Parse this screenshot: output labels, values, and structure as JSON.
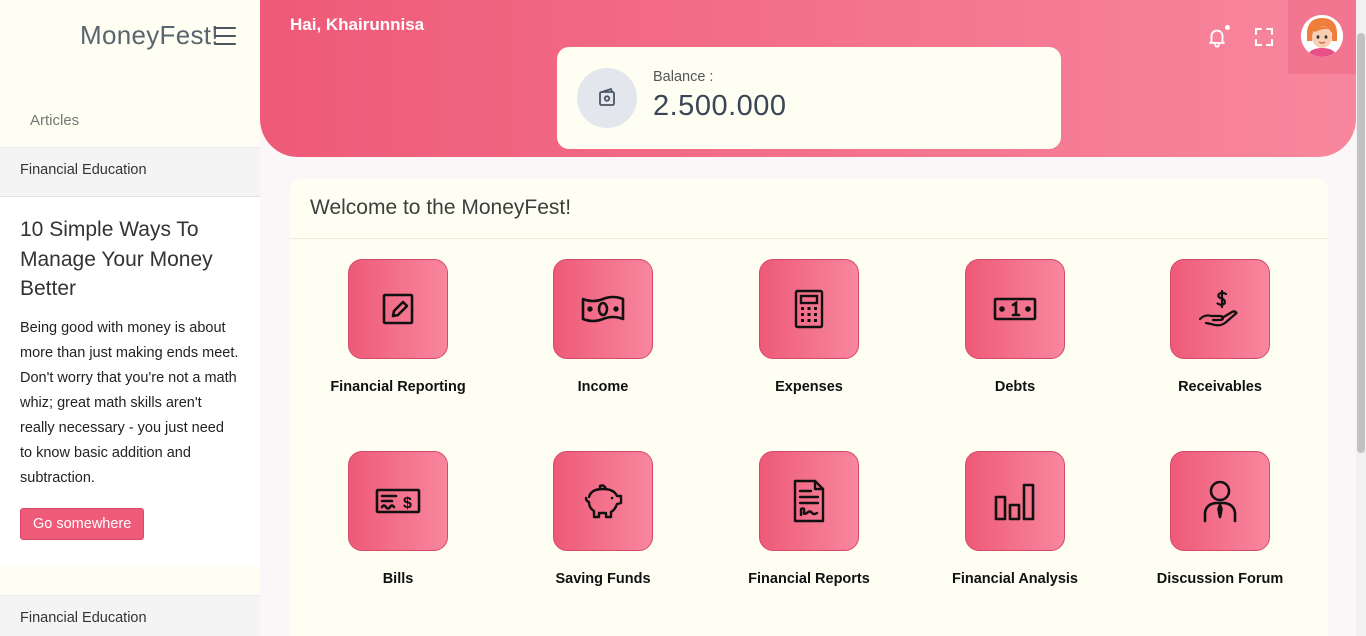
{
  "brand": "MoneyFest!",
  "sidebar": {
    "section_title": "Articles",
    "cards": [
      {
        "category": "Financial Education",
        "title": "10 Simple Ways To Manage Your Money Better",
        "text": "Being good with money is about more than just making ends meet. Don't worry that you're not a math whiz; great math skills aren't really necessary - you just need to know basic addition and subtraction.",
        "button": "Go somewhere"
      },
      {
        "category": "Financial Education"
      }
    ]
  },
  "header": {
    "greeting": "Hai, Khairunnisa",
    "notification_icon": "bell-icon",
    "fullscreen_icon": "fullscreen-icon"
  },
  "balance": {
    "label": "Balance :",
    "value": "2.500.000",
    "icon": "wallet-icon"
  },
  "main": {
    "title": "Welcome to the MoneyFest!",
    "features": [
      {
        "label": "Financial Reporting",
        "icon": "edit-icon"
      },
      {
        "label": "Income",
        "icon": "money-icon"
      },
      {
        "label": "Expenses",
        "icon": "calculator-icon"
      },
      {
        "label": "Debts",
        "icon": "banknote-icon"
      },
      {
        "label": "Receivables",
        "icon": "hand-dollar-icon"
      },
      {
        "label": "Bills",
        "icon": "check-icon"
      },
      {
        "label": "Saving Funds",
        "icon": "piggy-bank-icon"
      },
      {
        "label": "Financial Reports",
        "icon": "document-icon"
      },
      {
        "label": "Financial Analysis",
        "icon": "bar-chart-icon"
      },
      {
        "label": "Discussion Forum",
        "icon": "user-icon"
      }
    ]
  },
  "colors": {
    "accent": "#ee5a78",
    "accent_light": "#f8879e",
    "sidebar_bg": "#fefef2"
  }
}
